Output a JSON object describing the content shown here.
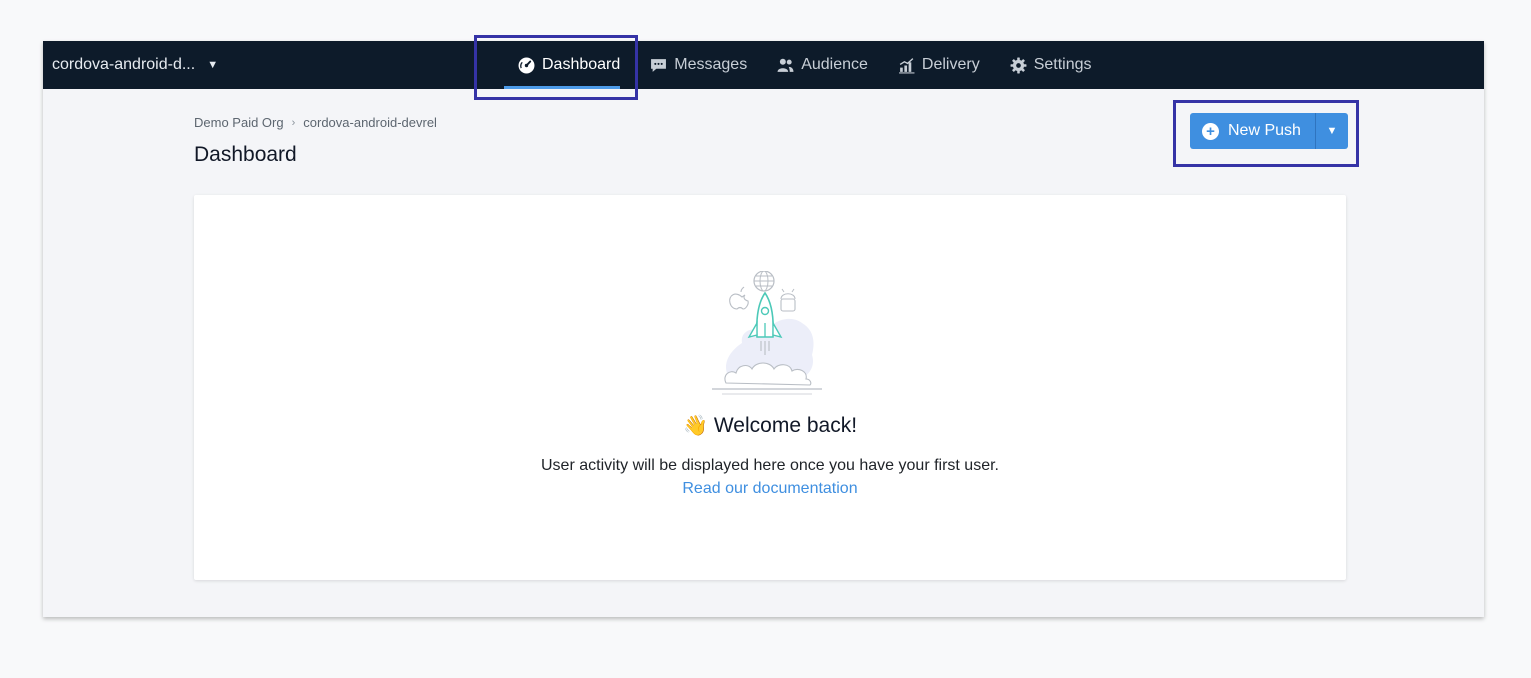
{
  "header": {
    "app_name": "cordova-android-d...",
    "tabs": [
      {
        "label": "Dashboard",
        "icon": "dashboard-gauge-icon",
        "active": true
      },
      {
        "label": "Messages",
        "icon": "chat-bubble-icon",
        "active": false
      },
      {
        "label": "Audience",
        "icon": "users-icon",
        "active": false
      },
      {
        "label": "Delivery",
        "icon": "chart-icon",
        "active": false
      },
      {
        "label": "Settings",
        "icon": "gear-icon",
        "active": false
      }
    ]
  },
  "breadcrumb": {
    "org": "Demo Paid Org",
    "app": "cordova-android-devrel"
  },
  "page": {
    "title": "Dashboard",
    "new_push_label": "New Push"
  },
  "empty_state": {
    "wave_emoji": "👋",
    "heading": "Welcome back!",
    "message": "User activity will be displayed here once you have your first user.",
    "link_text": "Read our documentation"
  },
  "colors": {
    "topbar": "#0d1b2a",
    "accent": "#3f8fe0",
    "highlight": "#3533a6"
  }
}
